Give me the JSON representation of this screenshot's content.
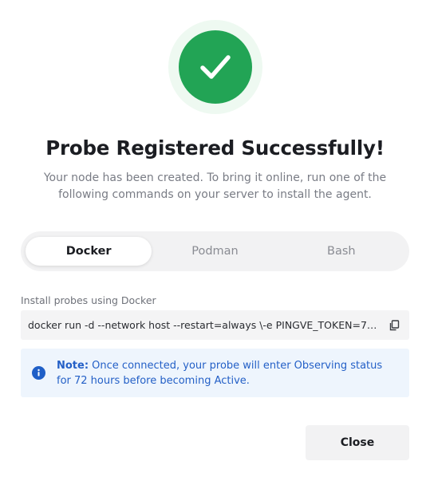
{
  "header": {
    "icon": "check-icon",
    "title": "Probe Registered Successfully!",
    "subtitle": "Your node has been created. To bring it online, run one of the following commands on your server to install the agent."
  },
  "tabs": [
    {
      "label": "Docker",
      "active": true
    },
    {
      "label": "Podman",
      "active": false
    },
    {
      "label": "Bash",
      "active": false
    }
  ],
  "install": {
    "label": "Install probes using Docker",
    "command": "docker run -d --network host --restart=always \\-e PINGVE_TOKEN=7a...",
    "copy_icon": "copy-icon"
  },
  "note": {
    "icon": "info-icon",
    "prefix": "Note:",
    "text": " Once connected, your probe will enter Observing status for 72 hours before becoming Active."
  },
  "footer": {
    "close_label": "Close"
  },
  "colors": {
    "success": "#22a455",
    "info": "#1f5fc7",
    "note_bg": "#eef5fd"
  }
}
